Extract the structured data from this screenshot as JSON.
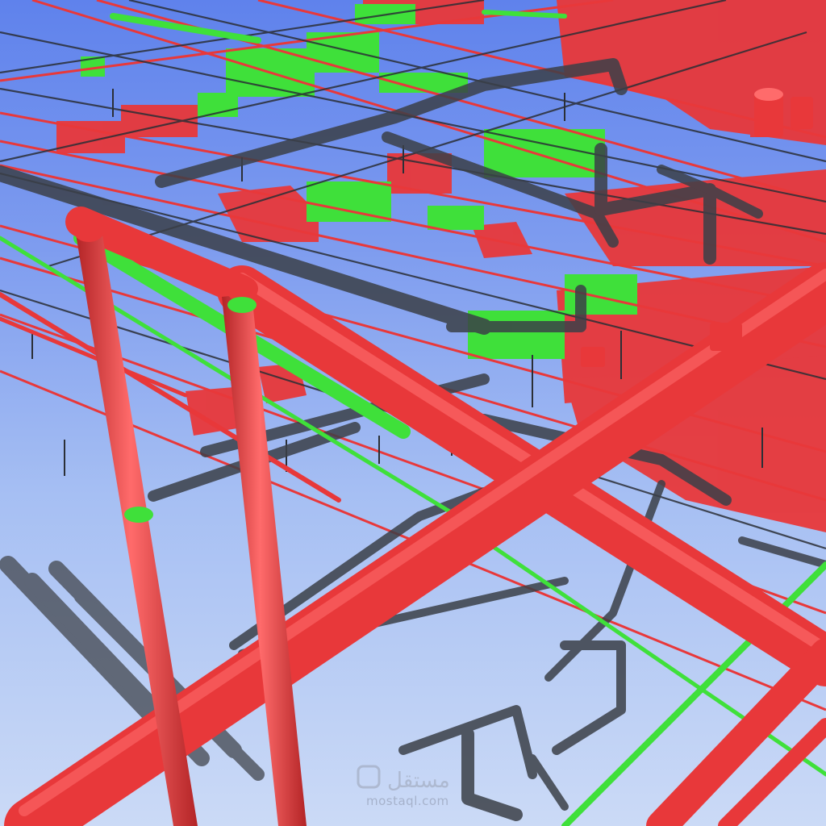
{
  "scene": {
    "description_kind": "3d-mep-model-render",
    "colors": {
      "background_top": "#5f82ec",
      "background_bottom": "#cbdaf6",
      "pipe_red": "#e8383a",
      "pipe_red_dark": "#b32426",
      "pipe_red_light": "#ff6b6b",
      "duct_green": "#3fe03a",
      "duct_green_dark": "#2aa826",
      "wire_gray": "#2b2f36",
      "wire_gray_light": "#5b616b"
    }
  },
  "watermark": {
    "arabic_text": "مستقل",
    "latin_text": "mostaql.com",
    "icon": "mostaql-logo-icon"
  }
}
